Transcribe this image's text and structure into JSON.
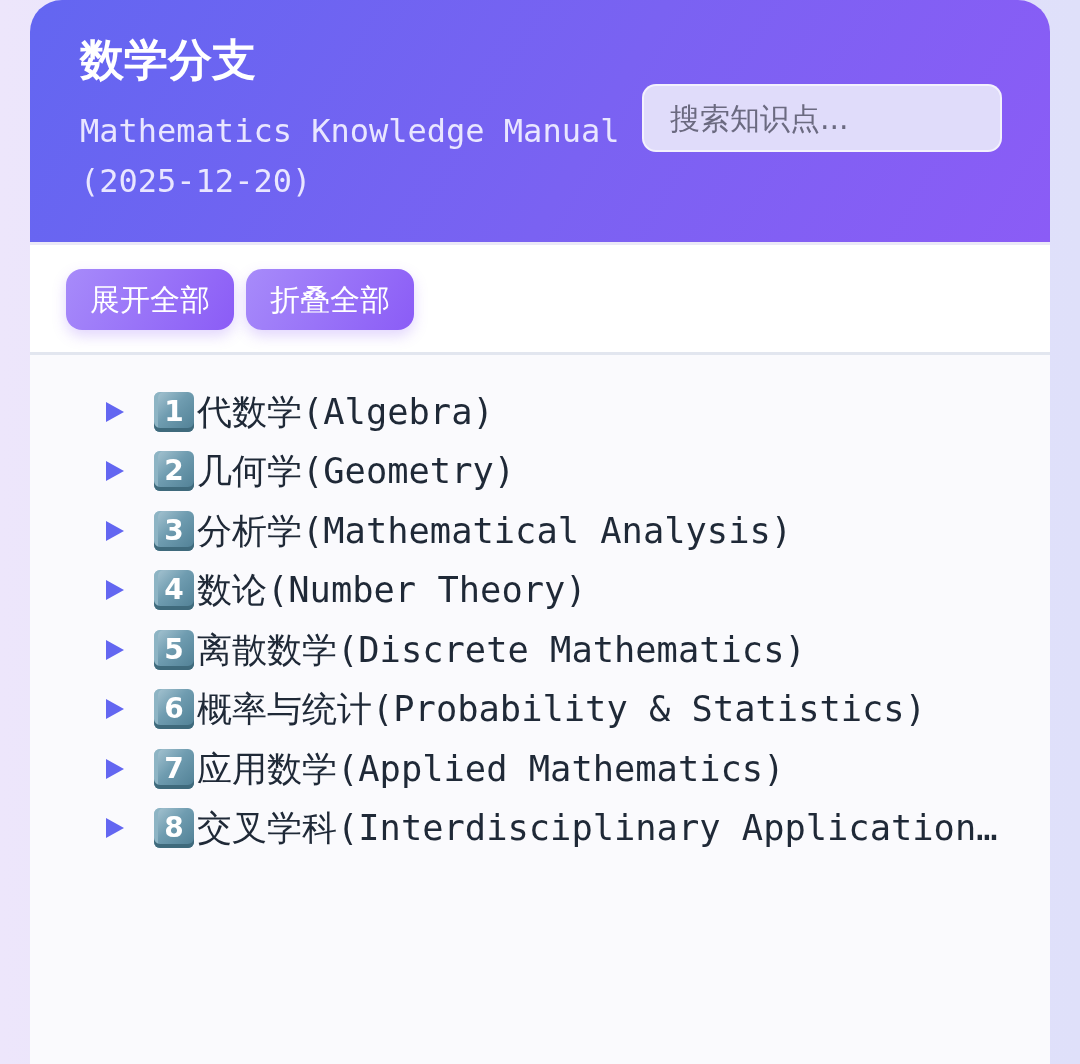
{
  "header": {
    "title": "数学分支",
    "subtitle": "Mathematics Knowledge Manual (2025-12-20)",
    "search": {
      "placeholder": "搜索知识点..."
    }
  },
  "toolbar": {
    "buttons": [
      "展开全部",
      "折叠全部"
    ]
  },
  "tree": {
    "items": [
      {
        "number": "1",
        "label": "代数学(Algebra)",
        "expanded": false
      },
      {
        "number": "2",
        "label": "几何学(Geometry)",
        "expanded": false
      },
      {
        "number": "3",
        "label": "分析学(Mathematical Analysis)",
        "expanded": false
      },
      {
        "number": "4",
        "label": "数论(Number Theory)",
        "expanded": false
      },
      {
        "number": "5",
        "label": "离散数学(Discrete Mathematics)",
        "expanded": false
      },
      {
        "number": "6",
        "label": "概率与统计(Probability & Statistics)",
        "expanded": false
      },
      {
        "number": "7",
        "label": "应用数学(Applied Mathematics)",
        "expanded": false
      },
      {
        "number": "8",
        "label": "交叉学科(Interdisciplinary Application…",
        "expanded": false
      }
    ]
  }
}
